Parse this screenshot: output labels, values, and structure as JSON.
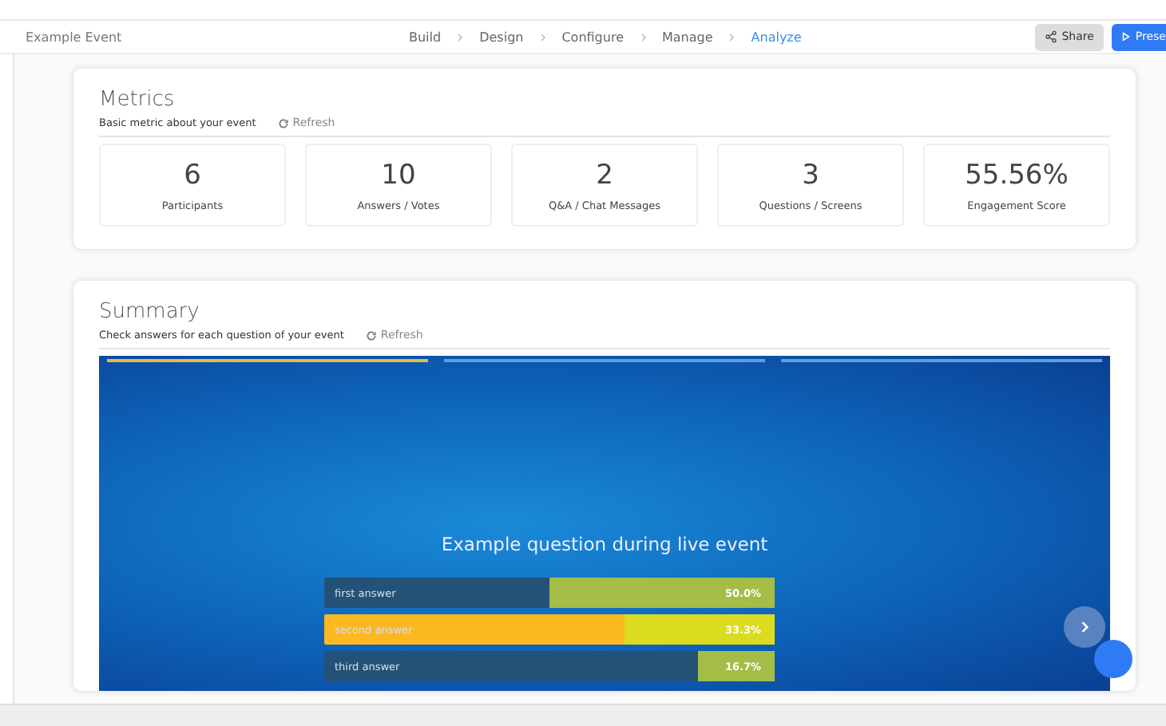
{
  "header": {
    "event_title": "Example Event",
    "steps": [
      {
        "label": "Build",
        "selected": false
      },
      {
        "label": "Design",
        "selected": false
      },
      {
        "label": "Configure",
        "selected": false
      },
      {
        "label": "Manage",
        "selected": false
      },
      {
        "label": "Analyze",
        "selected": true
      }
    ],
    "share_button": "Share",
    "present_button": "Prese"
  },
  "metrics": {
    "title": "Metrics",
    "subtitle": "Basic metric about your event",
    "refresh": "Refresh",
    "cards": [
      {
        "value": "6",
        "label": "Participants"
      },
      {
        "value": "10",
        "label": "Answers / Votes"
      },
      {
        "value": "2",
        "label": "Q&A / Chat Messages"
      },
      {
        "value": "3",
        "label": "Questions / Screens"
      },
      {
        "value": "55.56%",
        "label": "Engagement Score"
      }
    ]
  },
  "summary": {
    "title": "Summary",
    "subtitle": "Check answers for each question of your event",
    "refresh": "Refresh",
    "slide": {
      "progress": [
        {
          "selected": true
        },
        {
          "selected": false
        },
        {
          "selected": false
        }
      ],
      "question": "Example question during live event",
      "answers": [
        {
          "label": "first answer",
          "percent": "50.0%",
          "level": 0.5,
          "selected": false
        },
        {
          "label": "second answer",
          "percent": "33.3%",
          "level": 0.333,
          "selected": true
        },
        {
          "label": "third answer",
          "percent": "16.7%",
          "level": 0.167,
          "selected": false
        }
      ]
    }
  }
}
